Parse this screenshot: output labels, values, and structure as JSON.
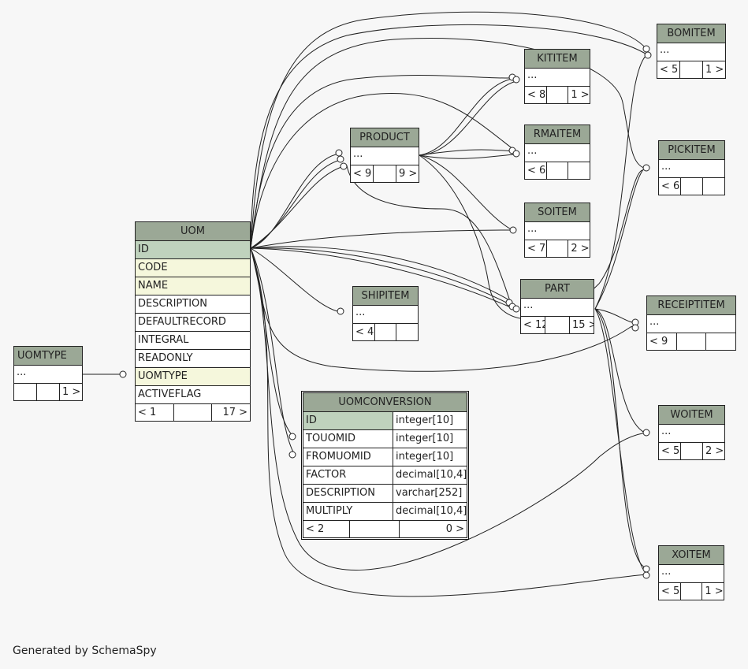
{
  "footer": {
    "credit": "Generated by SchemaSpy"
  },
  "tables": {
    "uomtype": {
      "name": "UOMTYPE",
      "ellipsis": "...",
      "footer": [
        "",
        "",
        "1 >"
      ]
    },
    "uom": {
      "name": "UOM",
      "columns": [
        "ID",
        "CODE",
        "NAME",
        "DESCRIPTION",
        "DEFAULTRECORD",
        "INTEGRAL",
        "READONLY",
        "UOMTYPE",
        "ACTIVEFLAG"
      ],
      "footer": [
        "< 1",
        "",
        "17 >"
      ]
    },
    "product": {
      "name": "PRODUCT",
      "ellipsis": "...",
      "footer": [
        "< 9",
        "",
        "9 >"
      ]
    },
    "shipitem": {
      "name": "SHIPITEM",
      "ellipsis": "...",
      "footer": [
        "< 4",
        "",
        ""
      ]
    },
    "kititem": {
      "name": "KITITEM",
      "ellipsis": "...",
      "footer": [
        "< 8",
        "",
        "1 >"
      ]
    },
    "rmaitem": {
      "name": "RMAITEM",
      "ellipsis": "...",
      "footer": [
        "< 6",
        "",
        ""
      ]
    },
    "soitem": {
      "name": "SOITEM",
      "ellipsis": "...",
      "footer": [
        "< 7",
        "",
        "2 >"
      ]
    },
    "part": {
      "name": "PART",
      "ellipsis": "...",
      "footer": [
        "< 12",
        "",
        "15 >"
      ]
    },
    "bomitem": {
      "name": "BOMITEM",
      "ellipsis": "...",
      "footer": [
        "< 5",
        "",
        "1 >"
      ]
    },
    "pickitem": {
      "name": "PICKITEM",
      "ellipsis": "...",
      "footer": [
        "< 6",
        "",
        ""
      ]
    },
    "receiptitem": {
      "name": "RECEIPTITEM",
      "ellipsis": "...",
      "footer": [
        "< 9",
        "",
        ""
      ]
    },
    "woitem": {
      "name": "WOITEM",
      "ellipsis": "...",
      "footer": [
        "< 5",
        "",
        "2 >"
      ]
    },
    "xoitem": {
      "name": "XOITEM",
      "ellipsis": "...",
      "footer": [
        "< 5",
        "",
        "1 >"
      ]
    },
    "uomconversion": {
      "name": "UOMCONVERSION",
      "columns": [
        {
          "name": "ID",
          "type": "integer[10]"
        },
        {
          "name": "TOUOMID",
          "type": "integer[10]"
        },
        {
          "name": "FROMUOMID",
          "type": "integer[10]"
        },
        {
          "name": "FACTOR",
          "type": "decimal[10,4]"
        },
        {
          "name": "DESCRIPTION",
          "type": "varchar[252]"
        },
        {
          "name": "MULTIPLY",
          "type": "decimal[10,4]"
        }
      ],
      "footer": [
        "< 2",
        "",
        "0 >"
      ]
    }
  }
}
